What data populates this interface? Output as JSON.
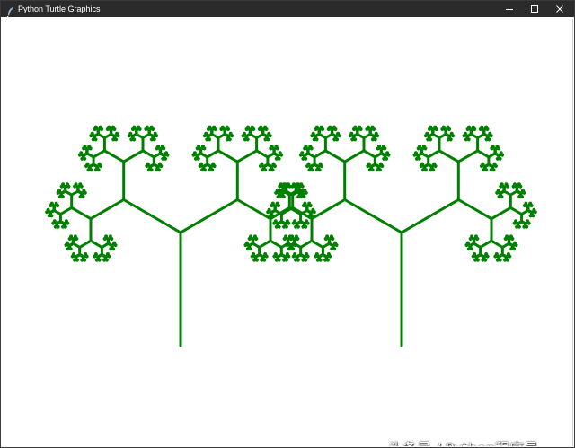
{
  "window": {
    "title": "Python Turtle Graphics",
    "icon": "turtle-feather-icon",
    "controls": {
      "minimize": "minimize-icon",
      "maximize": "maximize-icon",
      "close": "close-icon"
    }
  },
  "canvas": {
    "background": "#ffffff",
    "pen_color": "#008000"
  },
  "watermark": {
    "text": "头条号 / Python程序员"
  }
}
